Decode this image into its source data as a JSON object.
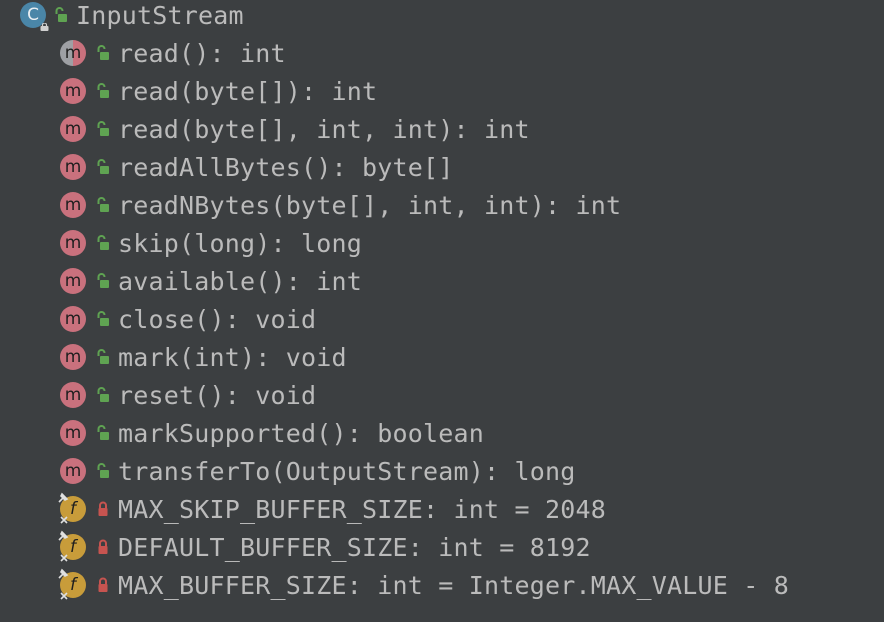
{
  "structure": {
    "class": {
      "name": "InputStream",
      "badge_letter": "C",
      "icon": "class-icon"
    },
    "members": [
      {
        "label": "read(): int",
        "kind": "method",
        "visibility": "public",
        "badge_letter": "m",
        "variant": "abstract"
      },
      {
        "label": "read(byte[]): int",
        "kind": "method",
        "visibility": "public",
        "badge_letter": "m"
      },
      {
        "label": "read(byte[], int, int): int",
        "kind": "method",
        "visibility": "public",
        "badge_letter": "m"
      },
      {
        "label": "readAllBytes(): byte[]",
        "kind": "method",
        "visibility": "public",
        "badge_letter": "m"
      },
      {
        "label": "readNBytes(byte[], int, int): int",
        "kind": "method",
        "visibility": "public",
        "badge_letter": "m"
      },
      {
        "label": "skip(long): long",
        "kind": "method",
        "visibility": "public",
        "badge_letter": "m"
      },
      {
        "label": "available(): int",
        "kind": "method",
        "visibility": "public",
        "badge_letter": "m"
      },
      {
        "label": "close(): void",
        "kind": "method",
        "visibility": "public",
        "badge_letter": "m"
      },
      {
        "label": "mark(int): void",
        "kind": "method",
        "visibility": "public",
        "badge_letter": "m"
      },
      {
        "label": "reset(): void",
        "kind": "method",
        "visibility": "public",
        "badge_letter": "m"
      },
      {
        "label": "markSupported(): boolean",
        "kind": "method",
        "visibility": "public",
        "badge_letter": "m"
      },
      {
        "label": "transferTo(OutputStream): long",
        "kind": "method",
        "visibility": "public",
        "badge_letter": "m"
      },
      {
        "label": "MAX_SKIP_BUFFER_SIZE: int = 2048",
        "kind": "field",
        "visibility": "private",
        "badge_letter": "f"
      },
      {
        "label": "DEFAULT_BUFFER_SIZE: int = 8192",
        "kind": "field",
        "visibility": "private",
        "badge_letter": "f"
      },
      {
        "label": "MAX_BUFFER_SIZE: int = Integer.MAX_VALUE - 8",
        "kind": "field",
        "visibility": "private",
        "badge_letter": "f"
      }
    ]
  },
  "colors": {
    "background": "#3c3f41",
    "text": "#bbbbbb",
    "class_badge": "#4a86a8",
    "method_badge": "#c9717d",
    "field_badge": "#c89c3a",
    "public_icon": "#5fa352",
    "private_icon": "#c75450"
  }
}
